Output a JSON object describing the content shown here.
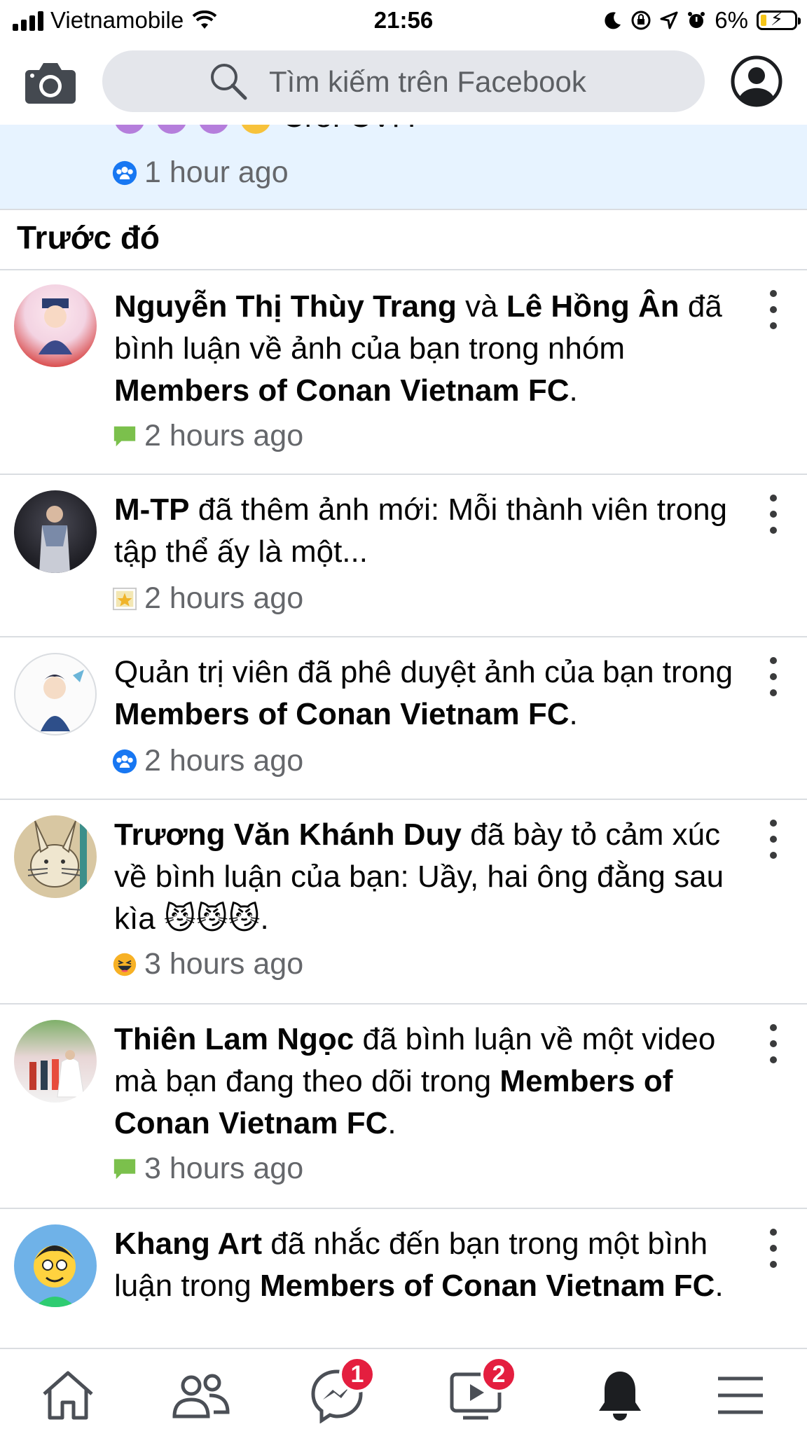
{
  "status_bar": {
    "carrier": "Vietnamobile",
    "time": "21:56",
    "battery": "6%",
    "battery_level": 0.06
  },
  "header": {
    "search_placeholder": "Tìm kiếm trên Facebook"
  },
  "previous_item": {
    "text_tail": "Cre: CVF.",
    "time": "1 hour ago",
    "type_icon": "group-icon"
  },
  "section": {
    "title": "Trước đó"
  },
  "notifications": [
    {
      "actor": "Nguyễn Thị Thùy Trang",
      "connector": " và ",
      "actor2": "Lê Hồng Ân",
      "action": " đã bình luận về ảnh của bạn trong nhóm ",
      "group": "Members of Conan Vietnam FC",
      "end": ".",
      "time": "2 hours ago",
      "type_icon": "comment-icon"
    },
    {
      "actor": "M-TP",
      "action": " đã thêm ảnh mới: Mỗi thành viên trong tập thể ấy là một...",
      "time": "2 hours ago",
      "type_icon": "photo-icon"
    },
    {
      "prefix": "Quản trị viên đã phê duyệt ảnh của bạn trong ",
      "group": "Members of Conan Vietnam FC",
      "end": ".",
      "time": "2 hours ago",
      "type_icon": "group-icon"
    },
    {
      "actor": "Trương Văn Khánh Duy",
      "action": " đã bày tỏ cảm xúc về bình luận của bạn: Uầy, hai ông đằng sau kìa ",
      "end": ".",
      "time": "3 hours ago",
      "type_icon": "haha-reaction-icon"
    },
    {
      "actor": "Thiên Lam Ngọc",
      "action": " đã bình luận về một video mà bạn đang theo dõi trong ",
      "group": "Members of Conan Vietnam FC",
      "end": ".",
      "time": "3 hours ago",
      "type_icon": "comment-icon"
    },
    {
      "actor": "Khang Art",
      "action": " đã nhắc đến bạn trong một bình luận trong ",
      "group": "Members of Conan Vietnam FC",
      "end": "."
    }
  ],
  "bottom_nav": {
    "home": "home-icon",
    "friends": "friends-icon",
    "messenger_badge": "1",
    "watch_badge": "2",
    "notifications": "bell-icon",
    "menu": "menu-icon"
  },
  "colors": {
    "highlight_bg": "#e7f3ff",
    "badge_red": "#e41e3f",
    "meta_gray": "#65676b",
    "facebook_blue": "#1877f2"
  }
}
